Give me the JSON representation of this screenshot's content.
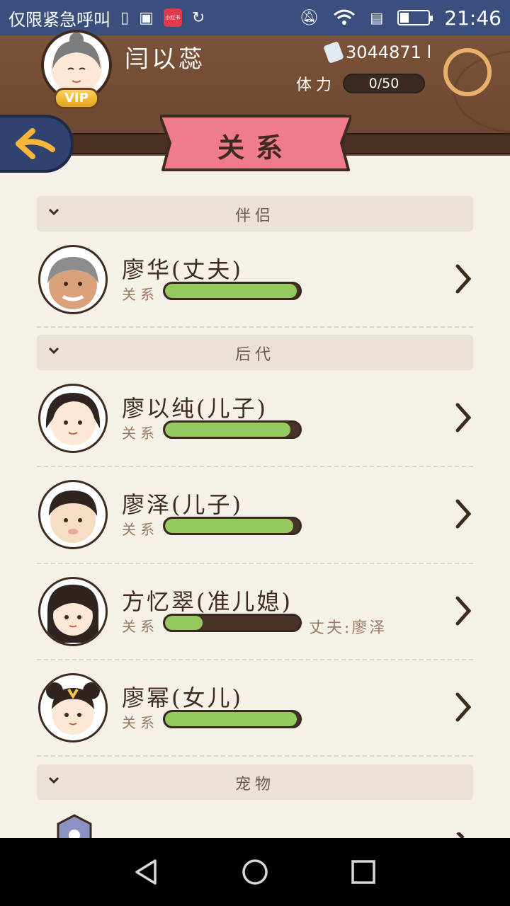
{
  "status_bar": {
    "carrier": "仅限紧急呼叫",
    "app_badge": "小红书",
    "time": "21:46",
    "battery_level": 0.3
  },
  "header": {
    "player_name": "闫以蕊",
    "vip_label": "VIP",
    "money": "3044871 l",
    "stamina_label": "体力",
    "stamina_value": "0/50"
  },
  "page": {
    "title": "关系"
  },
  "sections": {
    "partner": {
      "label": "伴侣"
    },
    "descendants": {
      "label": "后代"
    },
    "pets": {
      "label": "宠物"
    }
  },
  "relation_label": "关系",
  "people": [
    {
      "name": "廖华(丈夫)",
      "relation": 0.98,
      "note": ""
    },
    {
      "name": "廖以纯(儿子)",
      "relation": 0.93,
      "note": ""
    },
    {
      "name": "廖泽(儿子)",
      "relation": 0.95,
      "note": ""
    },
    {
      "name": "方忆翠(准儿媳)",
      "relation": 0.28,
      "note": "丈夫:廖泽"
    },
    {
      "name": "廖幂(女儿)",
      "relation": 0.98,
      "note": ""
    }
  ],
  "colors": {
    "status_bar": "#3b4f7e",
    "wood": "#7a5238",
    "ribbon": "#f07c8b",
    "bar_fill": "#95ca60",
    "bar_track": "#4a3328"
  }
}
